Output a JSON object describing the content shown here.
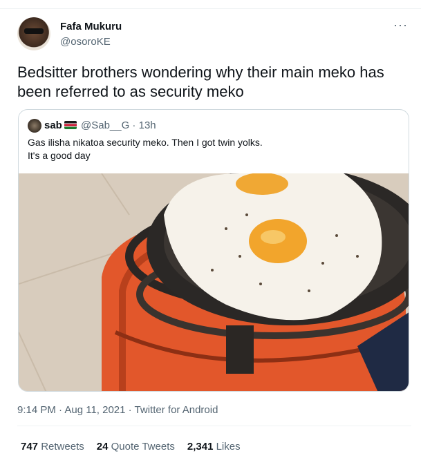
{
  "author": {
    "name": "Fafa Mukuru",
    "handle": "@osoroKE"
  },
  "more_label": "···",
  "tweet_text": "Bedsitter brothers wondering why their main meko has been referred to as security meko",
  "quoted": {
    "name": "sab",
    "handle_time": "@Sab__G · 13h",
    "text_line1": "Gas ilisha nikatoa security meko. Then I got twin yolks.",
    "text_line2": "It's a good day"
  },
  "timestamp": "9:14 PM · Aug 11, 2021 · Twitter for Android",
  "stats": {
    "retweets_count": "747",
    "retweets_label": "Retweets",
    "quotes_count": "24",
    "quotes_label": "Quote Tweets",
    "likes_count": "2,341",
    "likes_label": "Likes"
  },
  "colors": {
    "text": "#0f1419",
    "secondary": "#536471",
    "border": "#cfd9de",
    "cylinder": "#e2572b"
  }
}
